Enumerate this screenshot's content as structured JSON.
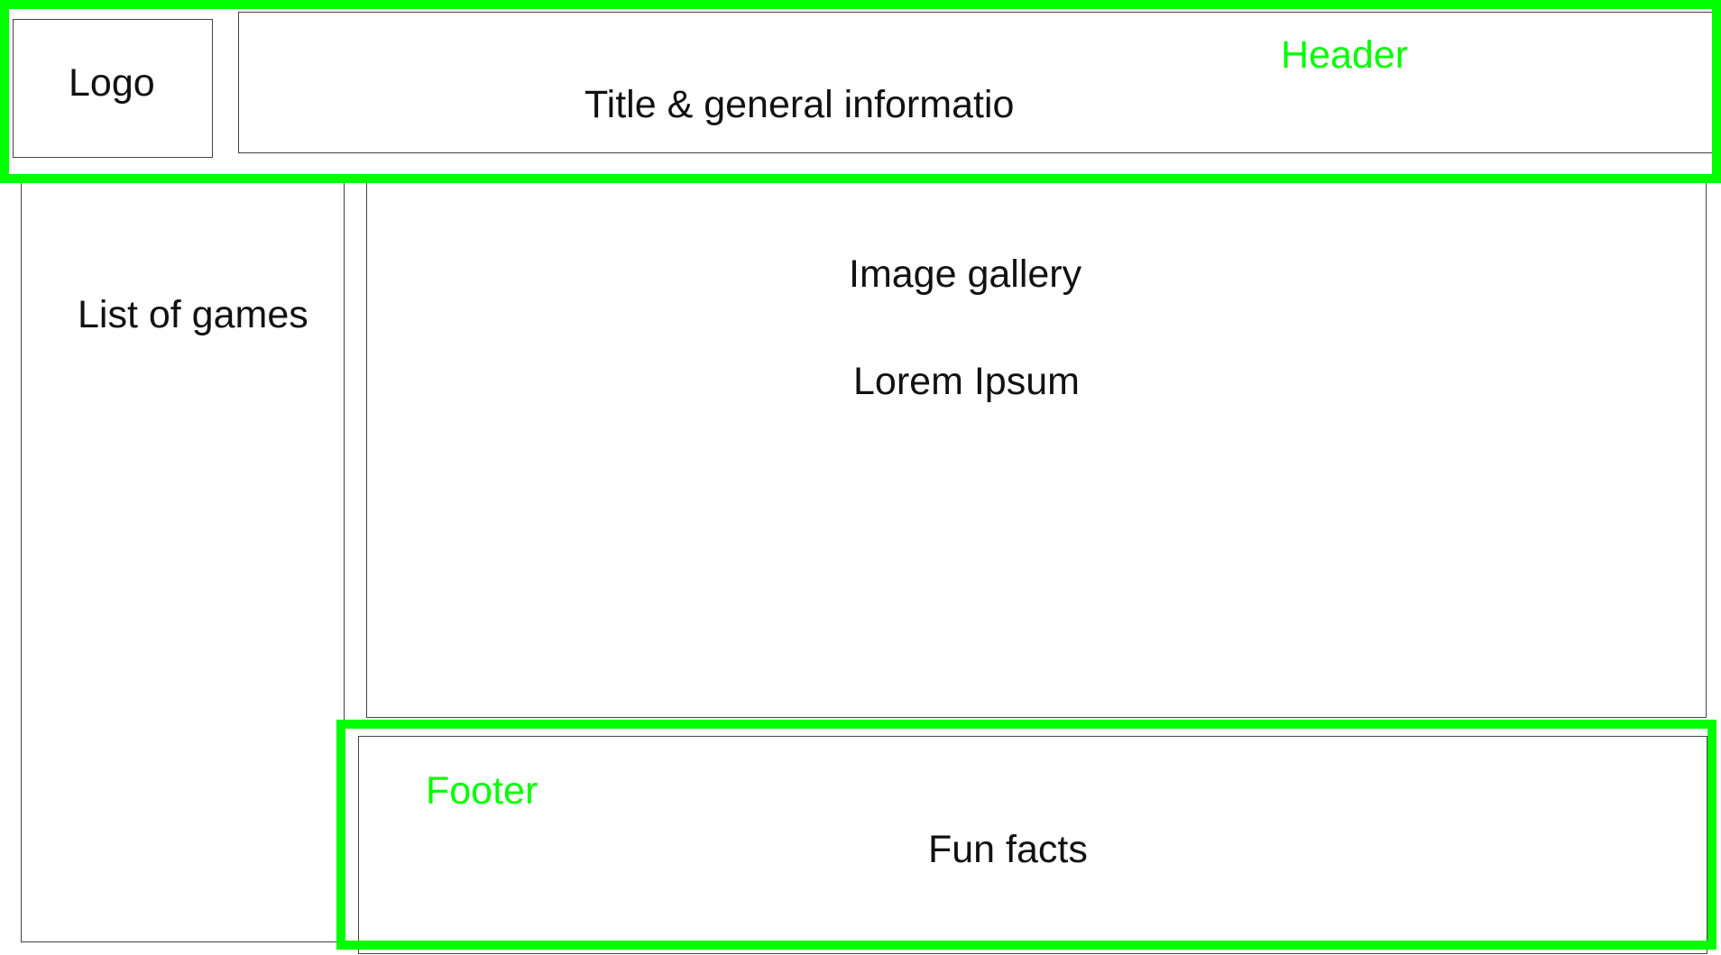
{
  "wireframe": {
    "logo": "Logo",
    "title_info": "Title & general informatio",
    "games": "List of games",
    "gallery": "Image gallery",
    "lorem": "Lorem Ipsum",
    "fun_facts": "Fun facts"
  },
  "annotations": {
    "header": "Header",
    "footer": "Footer"
  },
  "colors": {
    "annotation": "#00ff00",
    "border": "#444444",
    "text": "#111111"
  }
}
